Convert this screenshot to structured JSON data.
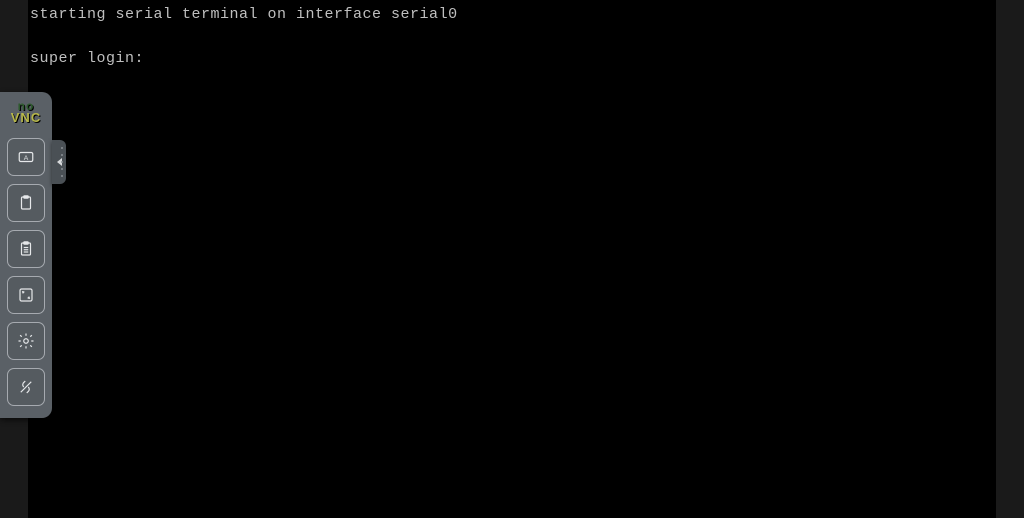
{
  "terminal": {
    "lines": [
      "starting serial terminal on interface serial0",
      "",
      "super login:"
    ]
  },
  "toolbar": {
    "logo": {
      "line1": "no",
      "line2": "VNC"
    },
    "buttons": [
      {
        "name": "keyboard-button",
        "icon": "keyboard"
      },
      {
        "name": "clipboard-button",
        "icon": "clipboard"
      },
      {
        "name": "clipboard-paste-button",
        "icon": "clipboard-lines"
      },
      {
        "name": "fullscreen-button",
        "icon": "fullscreen"
      },
      {
        "name": "settings-button",
        "icon": "gear"
      },
      {
        "name": "disconnect-button",
        "icon": "link-off"
      }
    ]
  }
}
